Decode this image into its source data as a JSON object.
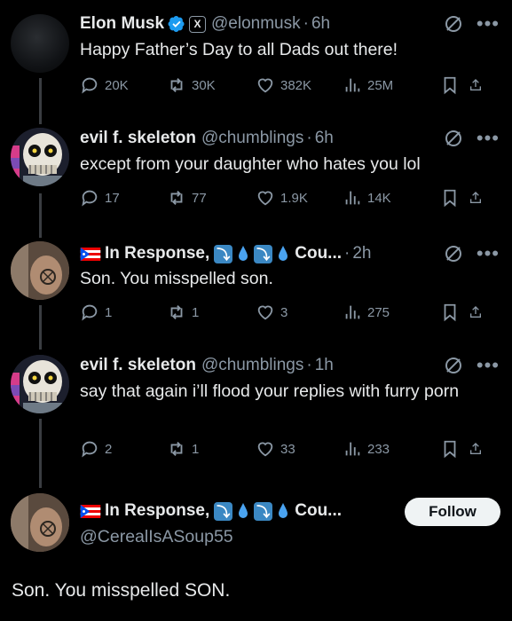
{
  "tweets": [
    {
      "name": "Elon Musk",
      "handle": "@elonmusk",
      "time": "6h",
      "text": "Happy Father’s Day to all Dads out there!",
      "replies": "20K",
      "retweets": "30K",
      "likes": "382K",
      "views": "25M"
    },
    {
      "name": "evil f. skeleton",
      "handle": "@chumblings",
      "time": "6h",
      "text": "except from your daughter who hates you lol",
      "replies": "17",
      "retweets": "77",
      "likes": "1.9K",
      "views": "14K"
    },
    {
      "name": "In Response,",
      "name_suffix": "Cou...",
      "time": "2h",
      "text": "Son. You misspelled son.",
      "replies": "1",
      "retweets": "1",
      "likes": "3",
      "views": "275"
    },
    {
      "name": "evil f. skeleton",
      "handle": "@chumblings",
      "time": "1h",
      "text": "say that again i’ll flood your replies with furry porn",
      "replies": "2",
      "retweets": "1",
      "likes": "33",
      "views": "233"
    }
  ],
  "focused": {
    "name": "In Response,",
    "name_suffix": "Cou...",
    "handle": "@CerealIsASoup55",
    "follow_label": "Follow",
    "text": "Son. You misspelled SON."
  },
  "badges": {
    "x_label": "X",
    "arrow_glyph": "⤵"
  },
  "icons": [
    "reply-icon",
    "retweet-icon",
    "like-icon",
    "views-icon",
    "bookmark-icon",
    "share-icon",
    "grok-icon",
    "more-icon",
    "verified-icon",
    "flag-icon",
    "droplet-icon"
  ],
  "colors": {
    "background": "#000000",
    "text": "#e7e9ea",
    "secondary": "#8b98a5",
    "verified": "#1d9bf0",
    "follow_bg": "#eff3f4"
  }
}
